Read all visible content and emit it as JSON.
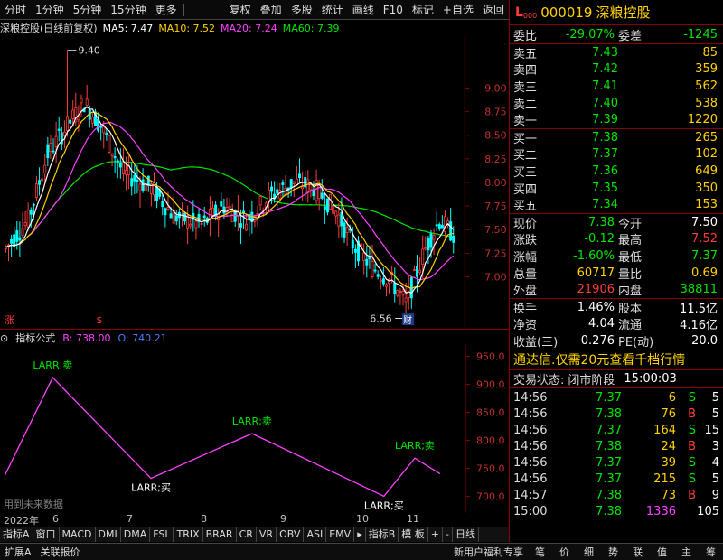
{
  "toolbar": {
    "left": [
      "分时",
      "1分钟",
      "5分钟",
      "15分钟",
      "更多"
    ],
    "right": [
      "复权",
      "叠加",
      "多股",
      "统计",
      "画线",
      "F10",
      "标记",
      "+自选",
      "返回"
    ]
  },
  "legend": {
    "title": "深粮控股(日线前复权)",
    "ma5": "MA5: 7.47",
    "ma10": "MA10: 7.52",
    "ma20": "MA20: 7.24",
    "ma60": "MA60: 7.39"
  },
  "colors": {
    "up": "#ff3c3c",
    "down": "#00ffff",
    "ma5": "#ffffff",
    "ma10": "#ffd200",
    "ma20": "#ff40ff",
    "ma60": "#00e600",
    "axis_border": "#800000",
    "indicator_line": "#ff40ff"
  },
  "price_axis": [
    "9.00",
    "8.75",
    "8.50",
    "8.25",
    "8.00",
    "7.75",
    "7.50",
    "7.25",
    "7.00"
  ],
  "annotations": {
    "high": "9.40",
    "low": "6.56",
    "cai": "财",
    "zhang": "涨",
    "s_marker": "$"
  },
  "indicator": {
    "name": "指标公式",
    "b": "B: 738.00",
    "o": "O: 740.21",
    "axis": [
      "950.0",
      "900.0",
      "850.0",
      "800.0",
      "750.0",
      "700.0"
    ],
    "labels": [
      {
        "text": "LARR;卖",
        "kind": "sell"
      },
      {
        "text": "LARR;买",
        "kind": "buy"
      },
      {
        "text": "LARR;卖",
        "kind": "sell"
      },
      {
        "text": "LARR;买",
        "kind": "buy"
      },
      {
        "text": "LARR;卖",
        "kind": "sell"
      }
    ],
    "future_note": "用到未来数据"
  },
  "dates": [
    "2022年",
    "6",
    "7",
    "8",
    "9",
    "10",
    "11"
  ],
  "tabs": [
    "指标A",
    "窗口",
    "MACD",
    "DMI",
    "DMA",
    "FSL",
    "TRIX",
    "BRAR",
    "CR",
    "VR",
    "OBV",
    "ASI",
    "EMV",
    "指标B",
    "模 板",
    "+",
    "-",
    "日线"
  ],
  "bottom": {
    "left": [
      "扩展A",
      "关联报价"
    ],
    "promo": "新用户福利专享",
    "right": [
      "笔",
      "价",
      "细",
      "势",
      "联",
      "值",
      "主",
      "筹"
    ]
  },
  "stock": {
    "badge": "L",
    "badge_sub": "000",
    "code": "000019",
    "name": "深粮控股"
  },
  "weibi": {
    "label1": "委比",
    "value1": "-29.07%",
    "label2": "委差",
    "value2": "-1245"
  },
  "asks": [
    {
      "label": "卖五",
      "price": "7.43",
      "vol": "85"
    },
    {
      "label": "卖四",
      "price": "7.42",
      "vol": "359"
    },
    {
      "label": "卖三",
      "price": "7.41",
      "vol": "562"
    },
    {
      "label": "卖二",
      "price": "7.40",
      "vol": "538"
    },
    {
      "label": "卖一",
      "price": "7.39",
      "vol": "1220"
    }
  ],
  "bids": [
    {
      "label": "买一",
      "price": "7.38",
      "vol": "265"
    },
    {
      "label": "买二",
      "price": "7.37",
      "vol": "102"
    },
    {
      "label": "买三",
      "price": "7.36",
      "vol": "649"
    },
    {
      "label": "买四",
      "price": "7.35",
      "vol": "350"
    },
    {
      "label": "买五",
      "price": "7.34",
      "vol": "153"
    }
  ],
  "quote": [
    {
      "l1": "现价",
      "v1": "7.38",
      "c1": "green",
      "l2": "今开",
      "v2": "7.50",
      "c2": "white"
    },
    {
      "l1": "涨跌",
      "v1": "-0.12",
      "c1": "green",
      "l2": "最高",
      "v2": "7.52",
      "c2": "red"
    },
    {
      "l1": "涨幅",
      "v1": "-1.60%",
      "c1": "green",
      "l2": "最低",
      "v2": "7.37",
      "c2": "green"
    },
    {
      "l1": "总量",
      "v1": "60717",
      "c1": "yellow",
      "l2": "量比",
      "v2": "0.69",
      "c2": "yellow"
    },
    {
      "l1": "外盘",
      "v1": "21906",
      "c1": "red",
      "l2": "内盘",
      "v2": "38811",
      "c2": "green"
    }
  ],
  "stats": [
    {
      "l1": "换手",
      "v1": "1.46%",
      "l2": "股本",
      "v2": "11.5亿"
    },
    {
      "l1": "净资",
      "v1": "4.04",
      "l2": "流通",
      "v2": "4.16亿"
    },
    {
      "l1": "收益(三)",
      "v1": "0.276",
      "l2": "PE(动)",
      "v2": "20.0"
    }
  ],
  "promo_line": "通达信.仅需20元查看千档行情",
  "trade_status": {
    "label": "交易状态:",
    "value": "闭市阶段",
    "time": "15:00:03"
  },
  "ticks": [
    {
      "t": "14:56",
      "p": "7.37",
      "v": "6",
      "bs": "S",
      "n": "5"
    },
    {
      "t": "14:56",
      "p": "7.38",
      "v": "76",
      "bs": "B",
      "n": "5"
    },
    {
      "t": "14:56",
      "p": "7.37",
      "v": "164",
      "bs": "S",
      "n": "15"
    },
    {
      "t": "14:56",
      "p": "7.38",
      "v": "24",
      "bs": "B",
      "n": "3"
    },
    {
      "t": "14:56",
      "p": "7.37",
      "v": "39",
      "bs": "S",
      "n": "4"
    },
    {
      "t": "14:56",
      "p": "7.37",
      "v": "215",
      "bs": "S",
      "n": "5"
    },
    {
      "t": "14:57",
      "p": "7.38",
      "v": "73",
      "bs": "B",
      "n": "9"
    },
    {
      "t": "15:00",
      "p": "7.38",
      "v": "1336",
      "bs": "",
      "n": "105"
    }
  ]
}
